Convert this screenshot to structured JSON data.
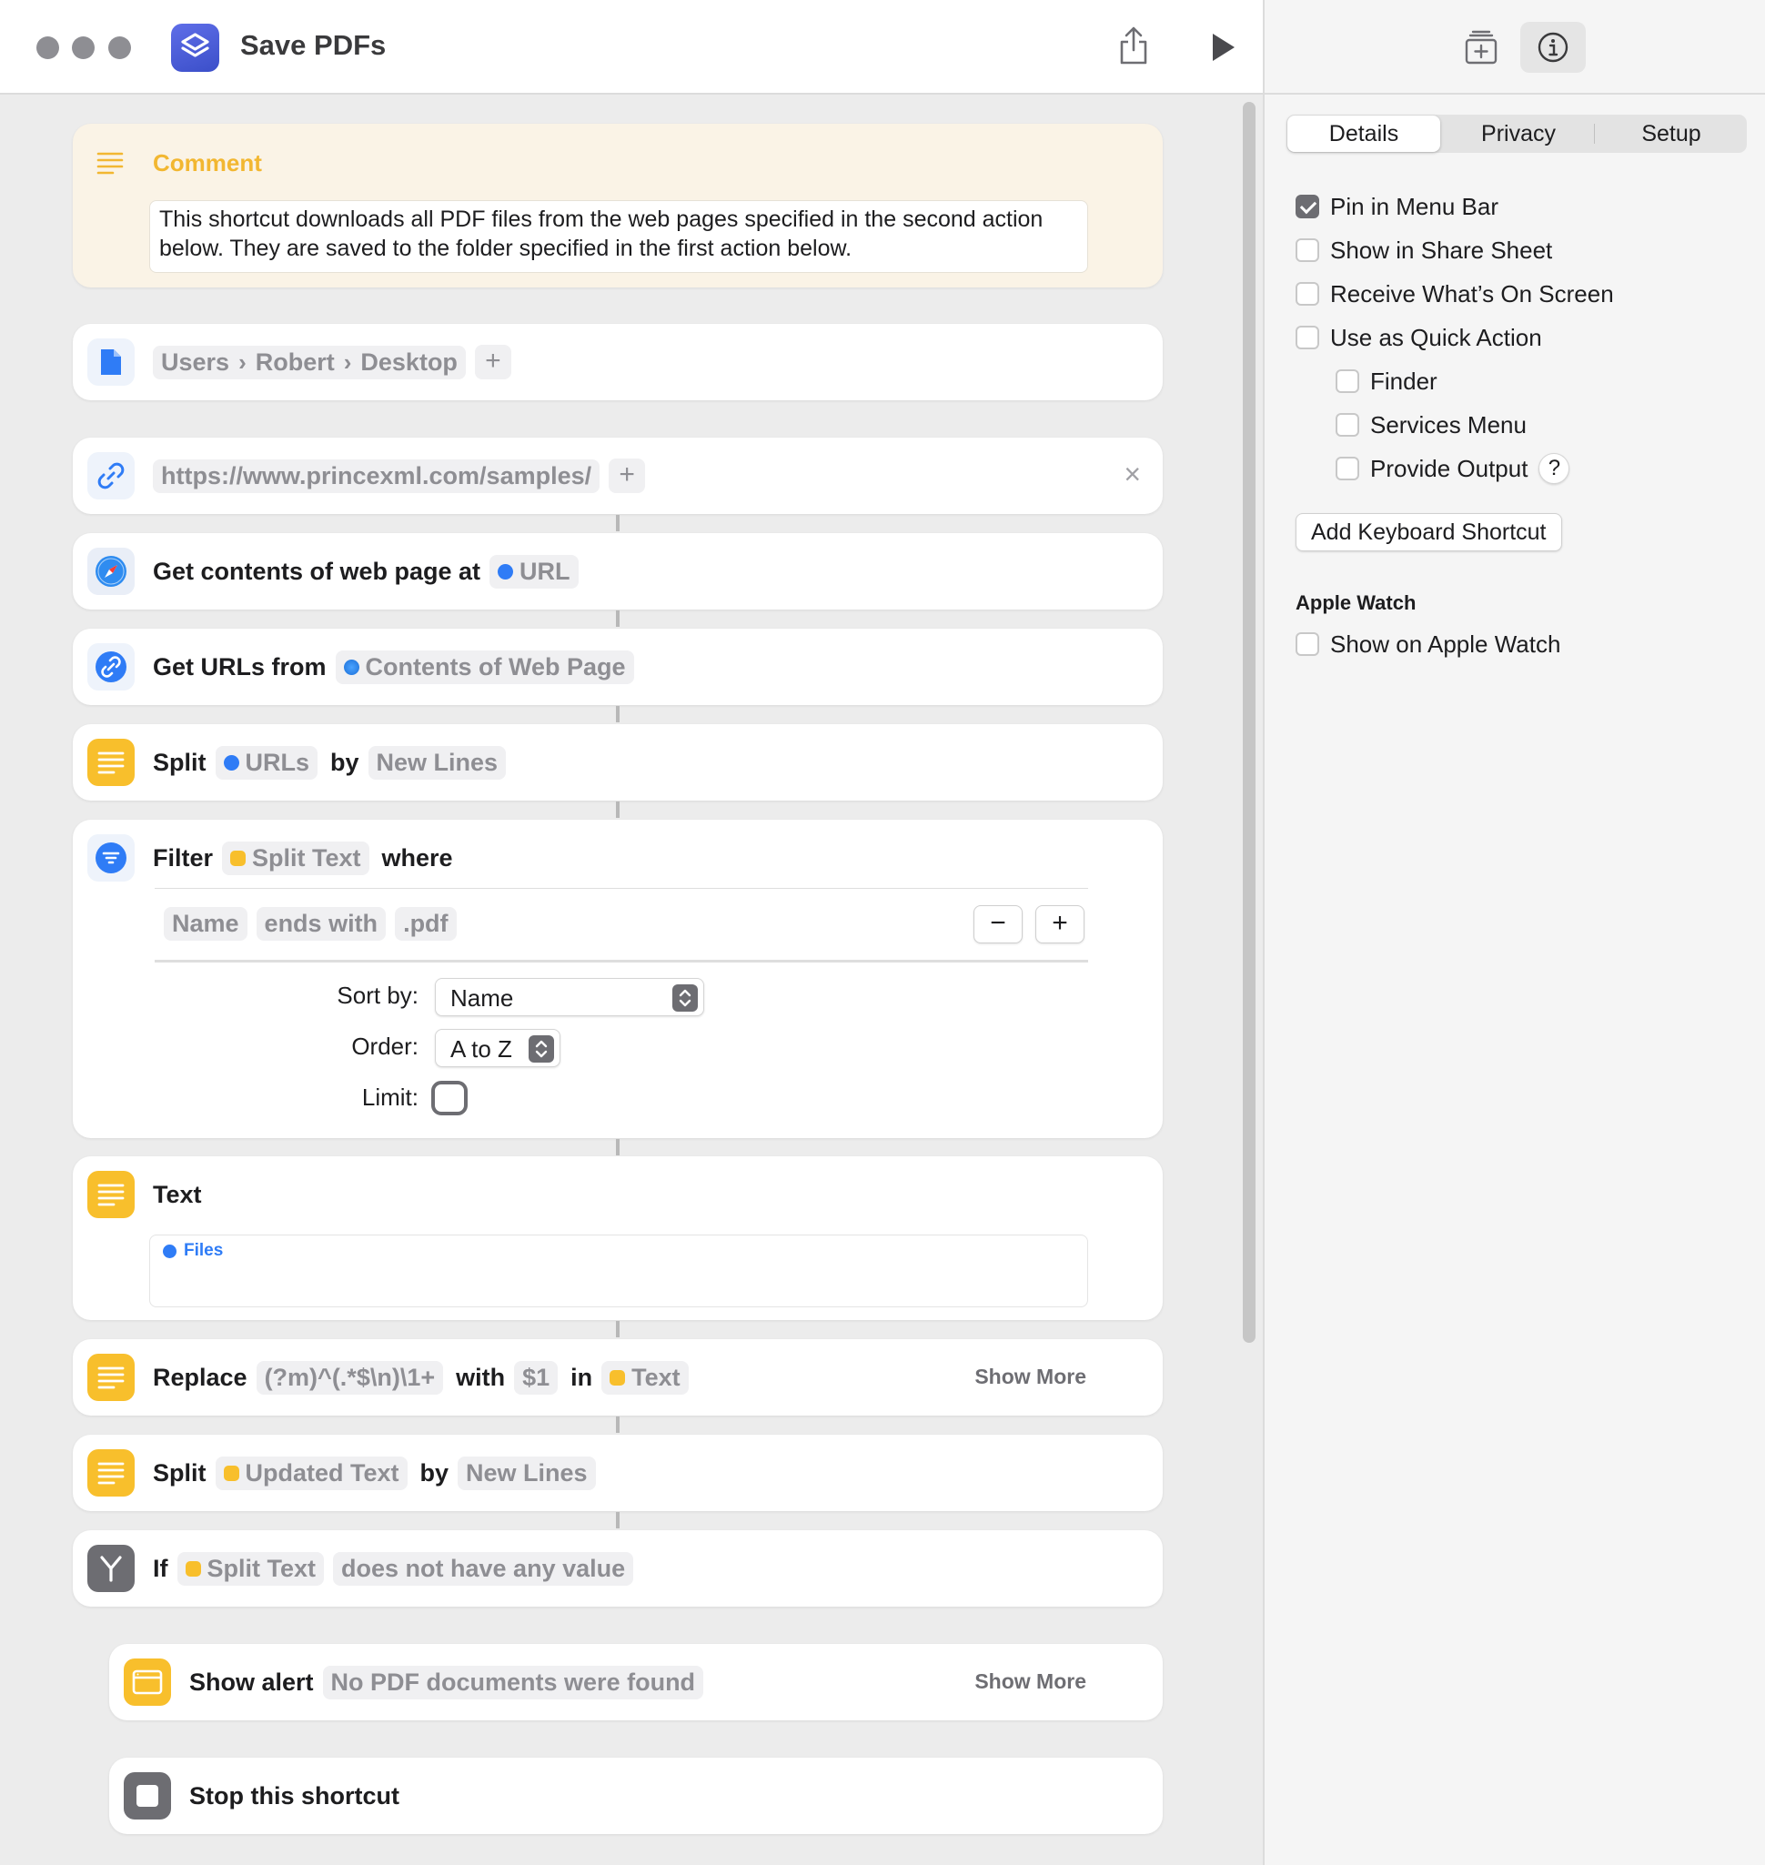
{
  "window": {
    "title": "Save PDFs"
  },
  "panel": {
    "tabs": [
      "Details",
      "Privacy",
      "Setup"
    ],
    "options": [
      {
        "label": "Pin in Menu Bar",
        "checked": true
      },
      {
        "label": "Show in Share Sheet",
        "checked": false
      },
      {
        "label": "Receive What’s On Screen",
        "checked": false
      },
      {
        "label": "Use as Quick Action",
        "checked": false
      },
      {
        "label": "Finder",
        "checked": false
      },
      {
        "label": "Services Menu",
        "checked": false
      },
      {
        "label": "Provide Output",
        "checked": false
      }
    ],
    "help_label": "?",
    "keyboard_shortcut_label": "Add Keyboard Shortcut",
    "apple_watch_heading": "Apple Watch",
    "apple_watch_option": {
      "label": "Show on Apple Watch",
      "checked": false
    }
  },
  "actions": {
    "comment": {
      "title": "Comment",
      "text": "This shortcut downloads all PDF files from the web pages specified in the second action below. They are saved to the folder specified in the first action below."
    },
    "folder": {
      "path": [
        "Users",
        "Robert",
        "Desktop"
      ],
      "add": "+"
    },
    "url": {
      "value": "https://www.princexml.com/samples/",
      "add": "+",
      "close": "×"
    },
    "get_contents": {
      "label": "Get contents of web page at",
      "token": "URL"
    },
    "get_urls": {
      "label": "Get URLs from",
      "token": "Contents of Web Page"
    },
    "split1": {
      "label": "Split",
      "token": "URLs",
      "by": "by",
      "separator": "New Lines"
    },
    "filter": {
      "label": "Filter",
      "token": "Split Text",
      "where": "where",
      "condition": {
        "property": "Name",
        "operator": "ends with",
        "value": ".pdf"
      },
      "minus": "−",
      "plus": "+",
      "sort_label": "Sort by:",
      "sort_value": "Name",
      "order_label": "Order:",
      "order_value": "A to Z",
      "limit_label": "Limit:"
    },
    "text": {
      "label": "Text",
      "token": "Files"
    },
    "replace": {
      "label": "Replace",
      "pattern": "(?m)^(.*$\\n)\\1+",
      "with": "with",
      "replacement": "$1",
      "in": "in",
      "token": "Text",
      "show_more": "Show More"
    },
    "split2": {
      "label": "Split",
      "token": "Updated Text",
      "by": "by",
      "separator": "New Lines"
    },
    "if": {
      "label": "If",
      "token": "Split Text",
      "condition": "does not have any value"
    },
    "alert": {
      "label": "Show alert",
      "message": "No PDF documents were found",
      "show_more": "Show More"
    },
    "stop": {
      "label": "Stop this shortcut"
    }
  },
  "colors": {
    "accent_yellow": "#f8bf2c",
    "accent_blue": "#2f7cf6",
    "checkbox_checked": "#6d6d72"
  }
}
